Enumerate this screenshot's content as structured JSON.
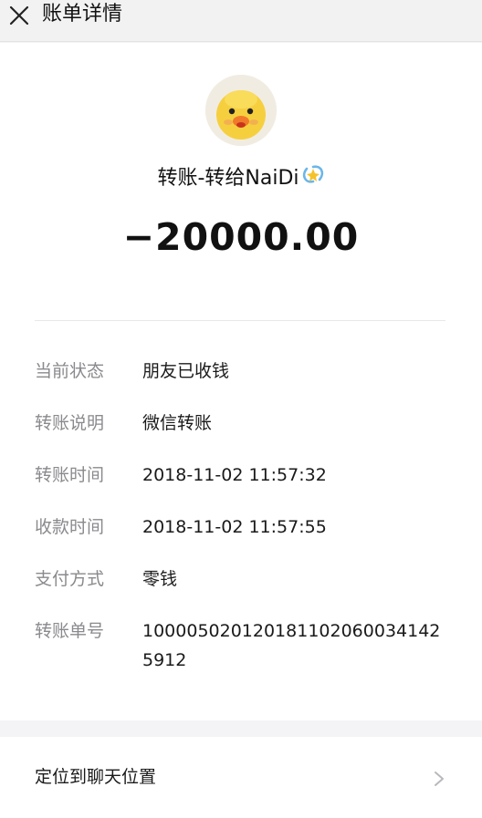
{
  "header": {
    "title": "账单详情",
    "close_icon": "close-icon"
  },
  "transfer": {
    "avatar_icon": "duck-avatar",
    "payee_text": "转账-转给NaiDi",
    "payee_emoji": "sparkle-emoji",
    "amount": "−20000.00"
  },
  "details": [
    {
      "label": "当前状态",
      "value": "朋友已收钱"
    },
    {
      "label": "转账说明",
      "value": "微信转账"
    },
    {
      "label": "转账时间",
      "value": "2018-11-02 11:57:32"
    },
    {
      "label": "收款时间",
      "value": "2018-11-02 11:57:55"
    },
    {
      "label": "支付方式",
      "value": "零钱"
    },
    {
      "label": "转账单号",
      "value": "100005020120181102060034142 5912"
    }
  ],
  "footer": {
    "locate_label": "定位到聊天位置",
    "chevron_icon": "chevron-right-icon"
  },
  "colors": {
    "background": "#f4f4f6",
    "card": "#ffffff",
    "label": "#8a8a8e",
    "text": "#1a1a1a"
  }
}
